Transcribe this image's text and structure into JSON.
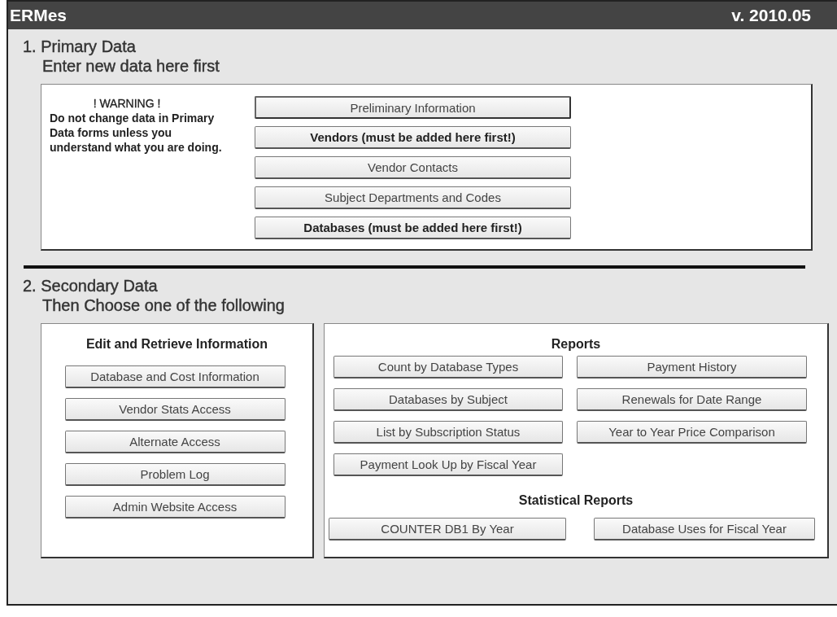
{
  "window": {
    "title": "ERMes",
    "version": "v. 2010.05"
  },
  "primary": {
    "heading": "1. Primary Data",
    "subheading": "Enter new data here first",
    "warning_title": "! WARNING !",
    "warning_text": "Do not change data in Primary Data forms unless you understand what you are doing.",
    "buttons": [
      {
        "label": "Preliminary Information",
        "kind": "normal",
        "focused": true
      },
      {
        "label": "Vendors (must be added here first!)",
        "kind": "bold",
        "focused": false
      },
      {
        "label": "Vendor Contacts",
        "kind": "normal",
        "focused": false
      },
      {
        "label": "Subject Departments and Codes",
        "kind": "normal",
        "focused": false
      },
      {
        "label": "Databases (must be added here first!)",
        "kind": "bold",
        "focused": false
      }
    ]
  },
  "secondary": {
    "heading": "2. Secondary Data",
    "subheading": "Then Choose one of the following",
    "edit_panel": {
      "title": "Edit and Retrieve Information",
      "buttons": [
        "Database and Cost Information",
        "Vendor Stats Access",
        "Alternate Access",
        "Problem Log",
        "Admin Website Access"
      ]
    },
    "reports_panel": {
      "title": "Reports",
      "buttons": [
        "Count by Database Types",
        "Payment History",
        "Databases by Subject",
        "Renewals for Date Range",
        "List by Subscription Status",
        "Year to Year Price Comparison",
        "Payment Look Up by Fiscal Year"
      ],
      "statistical_title": "Statistical Reports",
      "statistical_buttons": [
        "COUNTER DB1 By Year",
        "Database Uses for Fiscal Year"
      ]
    }
  }
}
